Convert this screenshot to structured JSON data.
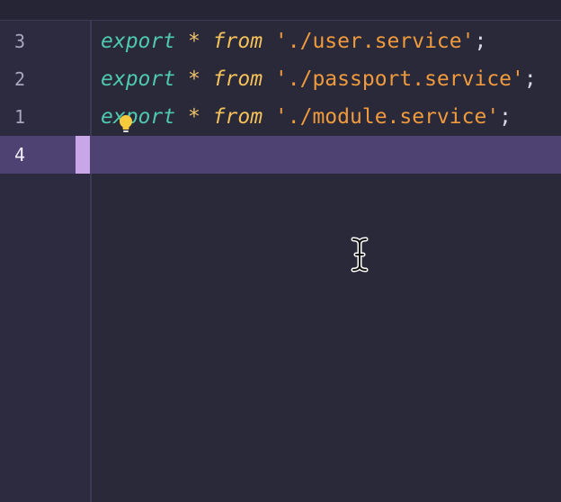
{
  "editor": {
    "lines": [
      {
        "number": "3",
        "keyword": "export",
        "star": "*",
        "from": "from",
        "path": "'./user.service'",
        "semicolon": ";"
      },
      {
        "number": "2",
        "keyword": "export",
        "star": "*",
        "from": "from",
        "path": "'./passport.service'",
        "semicolon": ";"
      },
      {
        "number": "1",
        "keyword": "export",
        "star": "*",
        "from": "from",
        "path": "'./module.service'",
        "semicolon": ";"
      },
      {
        "number": "4"
      }
    ],
    "current_line": "4",
    "icons": [
      "lightbulb-icon",
      "text-cursor-icon"
    ],
    "colors": {
      "background": "#2a2939",
      "gutter": "#2d2b40",
      "current_line": "#4d4272",
      "keyword": "#4ec9b0",
      "from": "#f4c15a",
      "string": "#f09a3e",
      "marker": "#c9a6e8"
    }
  }
}
